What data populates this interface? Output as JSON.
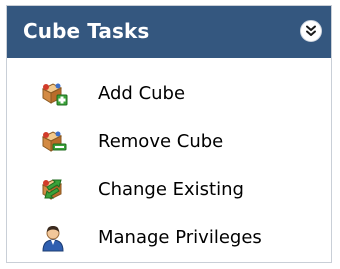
{
  "panel": {
    "title": "Cube Tasks",
    "header_color": "#34577f",
    "collapse_icon": "chevron-double-down-icon"
  },
  "tasks": [
    {
      "label": "Add Cube",
      "icon": "add-cube-icon"
    },
    {
      "label": "Remove Cube",
      "icon": "remove-cube-icon"
    },
    {
      "label": "Change Existing",
      "icon": "change-existing-icon"
    },
    {
      "label": "Manage Privileges",
      "icon": "user-privileges-icon"
    }
  ]
}
